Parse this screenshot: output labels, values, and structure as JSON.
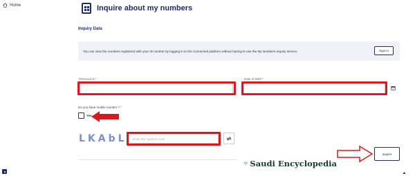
{
  "sidebar": {
    "home_label": "Home"
  },
  "header": {
    "title": "Inquire about my numbers"
  },
  "section": {
    "title": "Inquiry Data"
  },
  "info_box": {
    "text": "You can view the numbers registered with your ID number by logging in to the Connected platform without having to use the My Numbers Inquiry service.",
    "signin_label": "Sign in"
  },
  "form": {
    "personal_id_label": "Personal id *",
    "personal_id_value": "",
    "dob_label": "Date of Birth *",
    "dob_value": "",
    "mobile_question": "Do you have mobile number ? *",
    "yes_label": "Yes",
    "captcha_text": "LKAbL",
    "captcha_placeholder": "Enter the captcha code",
    "submit_label": "Inquire"
  },
  "watermark": {
    "text": "Saudi Encyclopedia"
  },
  "colors": {
    "brand": "#1d2b6b",
    "highlight": "#d71920",
    "info_bg": "#eef1f8",
    "captcha": "#7d8fc9"
  }
}
